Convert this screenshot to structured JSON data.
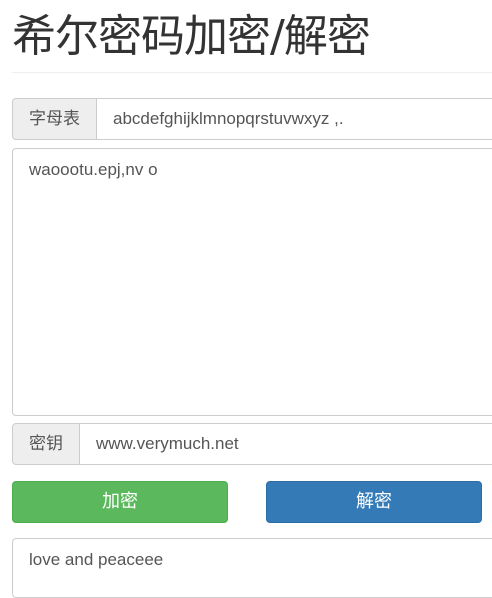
{
  "header": {
    "title": "希尔密码加密/解密"
  },
  "alphabet": {
    "label": "字母表",
    "value": "abcdefghijklmnopqrstuvwxyz ,."
  },
  "input": {
    "value": "waoootu.epj,nv o"
  },
  "key": {
    "label": "密钥",
    "value": "www.verymuch.net"
  },
  "buttons": {
    "encrypt_label": "加密",
    "decrypt_label": "解密"
  },
  "output": {
    "value": "love and peaceee"
  },
  "colors": {
    "encrypt_button": "#5cb85c",
    "decrypt_button": "#337ab7",
    "addon_background": "#eeeeee",
    "border": "#cccccc"
  }
}
